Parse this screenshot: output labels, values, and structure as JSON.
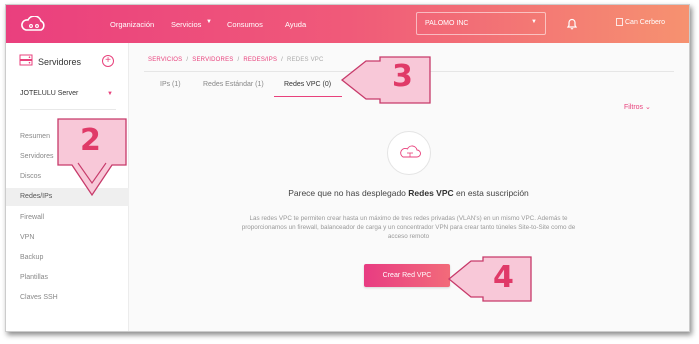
{
  "topbar": {
    "nav": [
      "Organización",
      "Servicios",
      "Consumos",
      "Ayuda"
    ],
    "company": "PALOMO INC",
    "avatar_alt": "Can Cerbero"
  },
  "sidebar": {
    "title": "Servidores",
    "server": "JOTELULU Server",
    "items": [
      "Resumen",
      "Servidores",
      "Discos",
      "Redes/IPs",
      "Firewall",
      "VPN",
      "Backup",
      "Plantillas",
      "Claves SSH"
    ]
  },
  "breadcrumb": {
    "items": [
      "SERVICIOS",
      "SERVIDORES",
      "REDES/IPS"
    ],
    "current": "REDES VPC"
  },
  "tabs": [
    "IPs (1)",
    "Redes Estándar (1)",
    "Redes VPC (0)"
  ],
  "filters_label": "Filtros",
  "empty_state": {
    "title_prefix": "Parece que no has desplegado",
    "title_bold": "Redes VPC",
    "title_suffix": "en esta suscripción",
    "description": "Las redes VPC te permiten crear hasta un máximo de tres redes privadas (VLAN's) en un mismo VPC. Además te proporcionamos un firewall, balanceador de carga y un concentrador VPN para crear tanto túneles Site-to-Site como de acceso remoto",
    "button": "Crear Red VPC"
  },
  "callouts": [
    "2",
    "3",
    "4"
  ],
  "colors": {
    "accent": "#e8417c",
    "callout_fill": "#f8c8d8",
    "callout_border": "#c73a6a"
  }
}
